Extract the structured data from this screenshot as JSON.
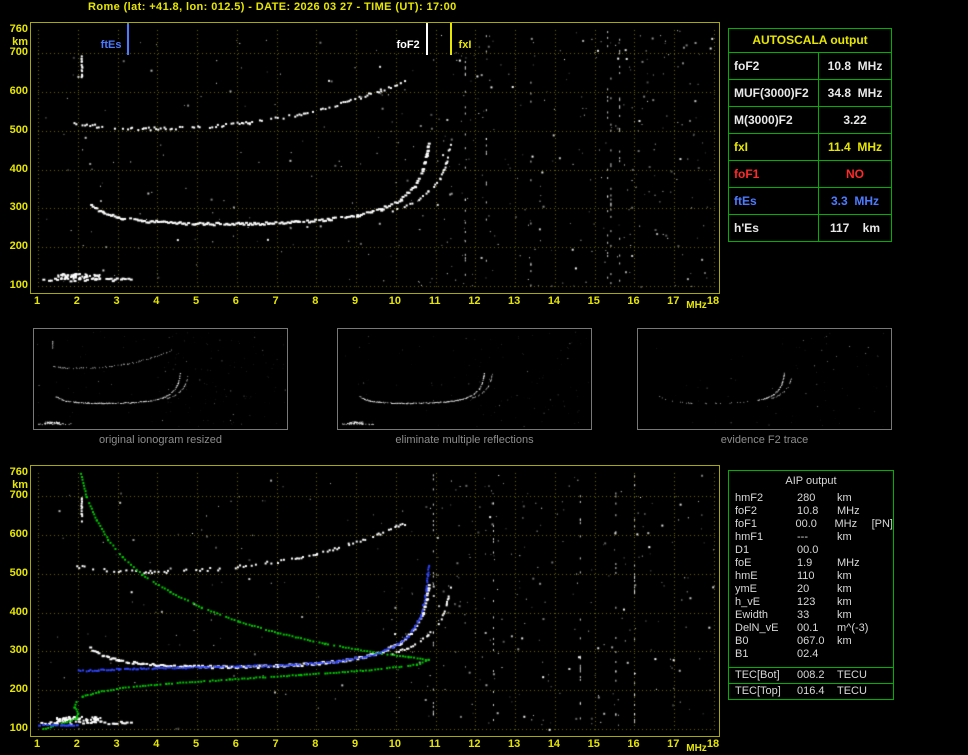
{
  "header": {
    "title": "Rome (lat: +41.8, lon: 012.5) - DATE: 2026 03 27 - TIME (UT): 17:00"
  },
  "colors": {
    "background": "#000000",
    "axis_text": "#e6e600",
    "grid": "#646400",
    "plot_border": "#a8a800",
    "trace": "#ffffff",
    "profile": "#00c800",
    "fitted": "#2e44ff",
    "table_border": "#00b000",
    "caption": "#8d8d8d"
  },
  "axes": {
    "y_unit": "km",
    "x_unit": "MHz",
    "y_ticks": [
      760,
      700,
      600,
      500,
      400,
      300,
      200,
      100
    ],
    "x_ticks": [
      1,
      2,
      3,
      4,
      5,
      6,
      7,
      8,
      9,
      10,
      11,
      12,
      13,
      14,
      15,
      16,
      17,
      18
    ],
    "x_range": [
      1,
      18
    ],
    "y_range": [
      100,
      760
    ]
  },
  "plots": {
    "top": {
      "markers": [
        {
          "label": "ftEs",
          "f": 3.3,
          "color": "#4d7bff",
          "side": "left"
        },
        {
          "label": "foF2",
          "f": 10.8,
          "color": "#ffffff",
          "side": "left"
        },
        {
          "label": "fxI",
          "f": 11.4,
          "color": "#e6e600",
          "side": "right"
        }
      ]
    },
    "bottom": {
      "markers": []
    }
  },
  "traces": {
    "es": {
      "points": [
        [
          1.05,
          118
        ],
        [
          3.3,
          118
        ]
      ],
      "skip": 0.45,
      "w": 3,
      "h": 2,
      "jy": 3
    },
    "es_blob": {
      "f": 2.0,
      "h": 127,
      "df": 0.55,
      "dh": 7,
      "n": 70
    },
    "v_spike": {
      "points": [
        [
          2.08,
          697
        ],
        [
          2.08,
          640
        ]
      ],
      "skip": 0.15,
      "w": 2,
      "h": 2,
      "jy": 2
    },
    "f_trace": {
      "points": [
        [
          2.3,
          310
        ],
        [
          2.6,
          292
        ],
        [
          3.0,
          278
        ],
        [
          3.6,
          270
        ],
        [
          4.5,
          264
        ],
        [
          5.5,
          262
        ],
        [
          6.5,
          263
        ],
        [
          7.5,
          267
        ],
        [
          8.3,
          274
        ],
        [
          9.0,
          284
        ],
        [
          9.6,
          300
        ],
        [
          10.1,
          325
        ],
        [
          10.45,
          360
        ],
        [
          10.65,
          400
        ],
        [
          10.75,
          440
        ],
        [
          10.8,
          472
        ]
      ],
      "skip": 0.12,
      "w": 3,
      "h": 2,
      "jy": 2.5
    },
    "x_trace": {
      "points": [
        [
          9.9,
          296
        ],
        [
          10.4,
          315
        ],
        [
          10.8,
          345
        ],
        [
          11.1,
          380
        ],
        [
          11.25,
          420
        ],
        [
          11.35,
          465
        ]
      ],
      "skip": 0.3,
      "w": 2,
      "h": 2,
      "jy": 2
    },
    "second_hop": {
      "points": [
        [
          1.9,
          522
        ],
        [
          2.6,
          512
        ],
        [
          3.5,
          507
        ],
        [
          4.5,
          509
        ],
        [
          5.5,
          515
        ],
        [
          6.3,
          523
        ],
        [
          7.2,
          537
        ],
        [
          8.0,
          555
        ],
        [
          8.8,
          578
        ],
        [
          9.6,
          606
        ],
        [
          10.2,
          632
        ]
      ],
      "skip": 0.5,
      "w": 2,
      "h": 2,
      "jy": 3
    },
    "profile": {
      "points": [
        [
          2.05,
          760
        ],
        [
          2.2,
          700
        ],
        [
          2.45,
          640
        ],
        [
          2.75,
          590
        ],
        [
          3.1,
          545
        ],
        [
          3.6,
          500
        ],
        [
          4.3,
          455
        ],
        [
          5.1,
          415
        ],
        [
          6.0,
          380
        ],
        [
          7.0,
          350
        ],
        [
          8.2,
          322
        ],
        [
          9.4,
          300
        ],
        [
          10.3,
          288
        ],
        [
          10.8,
          280
        ],
        [
          10.5,
          268
        ],
        [
          9.3,
          254
        ],
        [
          7.6,
          242
        ],
        [
          5.8,
          230
        ],
        [
          4.2,
          219
        ],
        [
          3.1,
          208
        ],
        [
          2.5,
          198
        ],
        [
          2.1,
          186
        ],
        [
          1.95,
          172
        ],
        [
          1.9,
          158
        ],
        [
          1.98,
          142
        ],
        [
          1.95,
          130
        ],
        [
          1.7,
          120
        ],
        [
          1.35,
          110
        ],
        [
          1.1,
          102
        ]
      ],
      "skip": 0.1,
      "step": 3,
      "w": 2,
      "h": 2,
      "jy": 0.8
    },
    "fitted": {
      "points": [
        [
          2.0,
          252
        ],
        [
          3.0,
          256
        ],
        [
          4.5,
          260
        ],
        [
          6.0,
          263
        ],
        [
          7.5,
          268
        ],
        [
          8.5,
          276
        ],
        [
          9.3,
          290
        ],
        [
          9.9,
          312
        ],
        [
          10.3,
          342
        ],
        [
          10.6,
          390
        ],
        [
          10.72,
          445
        ],
        [
          10.78,
          500
        ],
        [
          10.8,
          525
        ]
      ],
      "skip": 0.15,
      "w": 2,
      "h": 2,
      "jy": 1.5
    },
    "fitted_es": {
      "points": [
        [
          1.0,
          112
        ],
        [
          2.0,
          112
        ]
      ],
      "skip": 0.25,
      "w": 3,
      "h": 2,
      "jy": 1
    }
  },
  "noise": {
    "top": {
      "seed": 20260327,
      "count": 400,
      "streaks": 6
    },
    "bottom": {
      "seed": 1700,
      "count": 340,
      "streaks": 5
    },
    "thumb1": {
      "seed": 11,
      "count": 150
    },
    "thumb2": {
      "seed": 22,
      "count": 110
    },
    "thumb3": {
      "seed": 33,
      "count": 70
    }
  },
  "autoscala": {
    "title": "AUTOSCALA output",
    "rows": [
      {
        "label": "foF2",
        "value": "10.8  MHz",
        "color": "white"
      },
      {
        "label": "MUF(3000)F2",
        "value": "34.8  MHz",
        "color": "white"
      },
      {
        "label": "M(3000)F2",
        "value": "3.22",
        "color": "white"
      },
      {
        "label": "fxI",
        "value": "11.4  MHz",
        "color": "yellow"
      },
      {
        "label": "foF1",
        "value": "NO",
        "color": "red"
      },
      {
        "label": "ftEs",
        "value": "3.3  MHz",
        "color": "blue"
      },
      {
        "label": "h'Es",
        "value": "117    km",
        "color": "white"
      }
    ]
  },
  "aip": {
    "title": "AIP output",
    "rows": [
      {
        "name": "hmF2",
        "value": "280",
        "unit": "km",
        "note": ""
      },
      {
        "name": "foF2",
        "value": "10.8",
        "unit": "MHz",
        "note": ""
      },
      {
        "name": "foF1",
        "value": "00.0",
        "unit": "MHz",
        "note": "[PN]"
      },
      {
        "name": "hmF1",
        "value": "---",
        "unit": "km",
        "note": ""
      },
      {
        "name": "D1",
        "value": "00.0",
        "unit": "",
        "note": ""
      },
      {
        "name": "foE",
        "value": "1.9",
        "unit": "MHz",
        "note": ""
      },
      {
        "name": "hmE",
        "value": "110",
        "unit": "km",
        "note": ""
      },
      {
        "name": "ymE",
        "value": "20",
        "unit": "km",
        "note": ""
      },
      {
        "name": "h_vE",
        "value": "123",
        "unit": "km",
        "note": ""
      },
      {
        "name": "Ewidth",
        "value": "33",
        "unit": "km",
        "note": ""
      },
      {
        "name": "DelN_vE",
        "value": "00.1",
        "unit": "m^(-3)",
        "note": ""
      },
      {
        "name": "B0",
        "value": "067.0",
        "unit": "km",
        "note": ""
      },
      {
        "name": "B1",
        "value": "02.4",
        "unit": "",
        "note": ""
      }
    ],
    "tec": [
      {
        "name": "TEC[Bot]",
        "value": "008.2",
        "unit": "TECU"
      },
      {
        "name": "TEC[Top]",
        "value": "016.4",
        "unit": "TECU"
      }
    ]
  },
  "thumbs": [
    {
      "caption": "original ionogram resized"
    },
    {
      "caption": "eliminate multiple reflections"
    },
    {
      "caption": "evidence F2 trace"
    }
  ]
}
